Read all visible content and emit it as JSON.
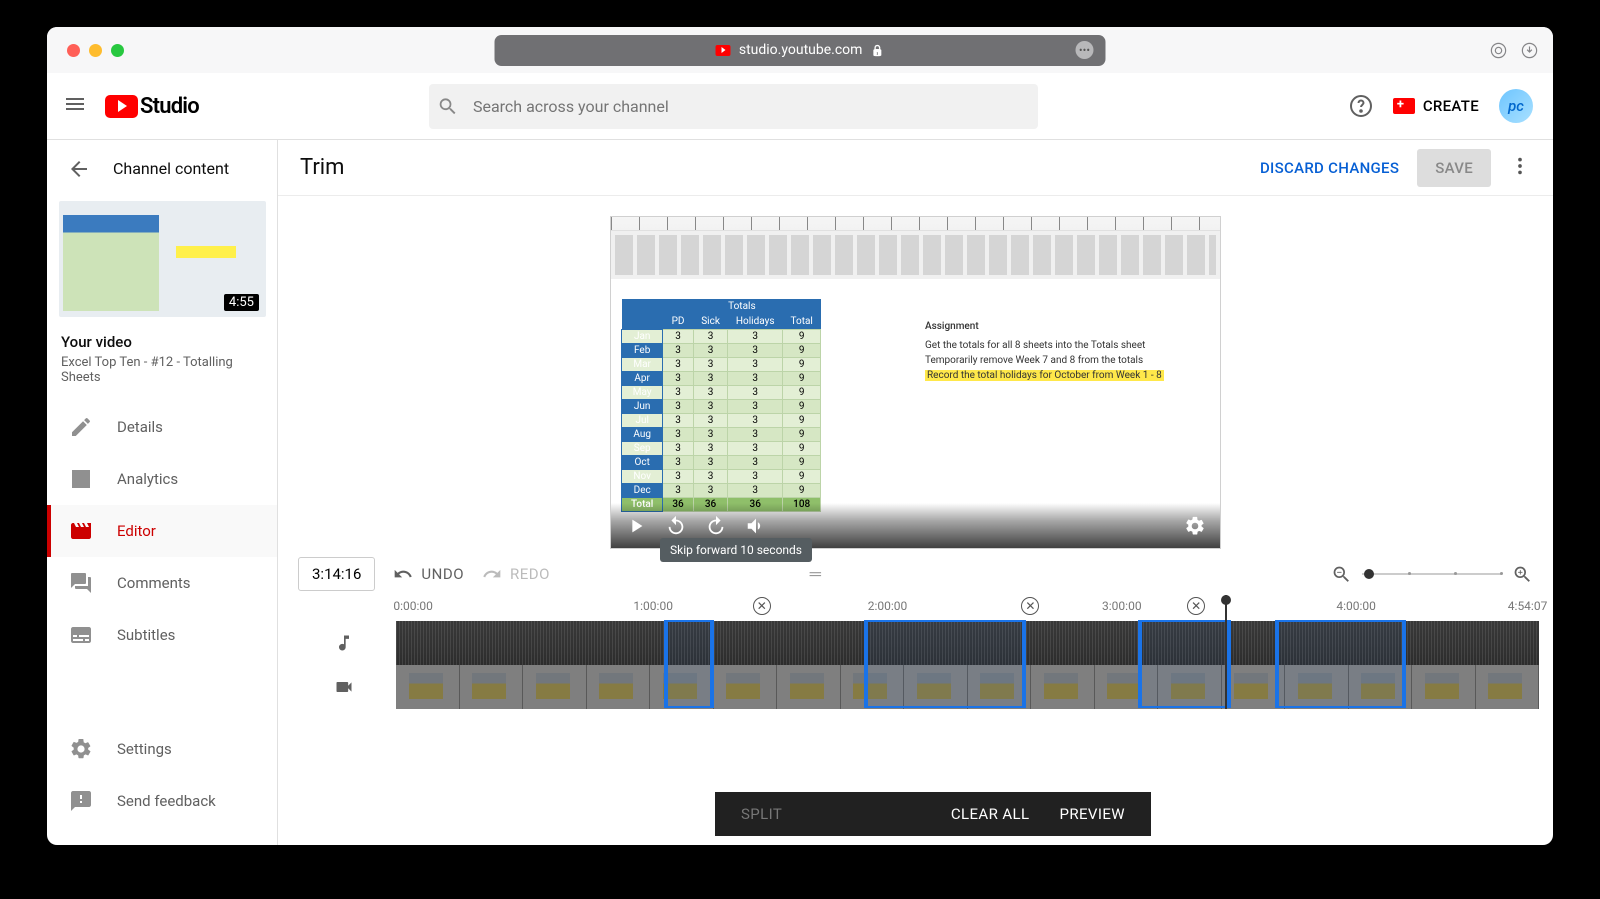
{
  "browser": {
    "url": "studio.youtube.com"
  },
  "header": {
    "logo_text": "Studio",
    "search_placeholder": "Search across your channel",
    "create_label": "CREATE",
    "avatar_text": "pc"
  },
  "sidebar": {
    "back_label": "Channel content",
    "thumb_duration": "4:55",
    "video_label": "Your video",
    "video_title": "Excel Top Ten - #12 - Totalling Sheets",
    "nav": [
      {
        "label": "Details"
      },
      {
        "label": "Analytics"
      },
      {
        "label": "Editor"
      },
      {
        "label": "Comments"
      },
      {
        "label": "Subtitles"
      }
    ],
    "settings_label": "Settings",
    "feedback_label": "Send feedback"
  },
  "page": {
    "title": "Trim",
    "discard_label": "DISCARD CHANGES",
    "save_label": "SAVE"
  },
  "preview": {
    "tooltip": "Skip forward 10 seconds",
    "assignment_title": "Assignment",
    "assignment_lines": [
      "Get the totals for all 8 sheets into the Totals sheet",
      "Temporarily remove Week 7 and 8 from the totals",
      "Record the total holidays for October from Week 1 - 8"
    ],
    "tbl_hdr": [
      "Totals",
      "PD",
      "Sick",
      "Holidays",
      "Total"
    ],
    "months": [
      "Jan",
      "Feb",
      "Mar",
      "Apr",
      "May",
      "Jun",
      "Jul",
      "Aug",
      "Sep",
      "Oct",
      "Nov",
      "Dec",
      "Total"
    ],
    "row_vals": [
      "3",
      "3",
      "3",
      "9"
    ],
    "total_vals": [
      "36",
      "36",
      "36",
      "108"
    ]
  },
  "timeline": {
    "timecode": "3:14:16",
    "undo_label": "UNDO",
    "redo_label": "REDO",
    "marks": [
      "0:00:00",
      "1:00:00",
      "2:00:00",
      "3:00:00",
      "4:00:00",
      "4:54:07"
    ]
  },
  "bottom": {
    "split": "SPLIT",
    "clear": "CLEAR ALL",
    "preview": "PREVIEW"
  }
}
